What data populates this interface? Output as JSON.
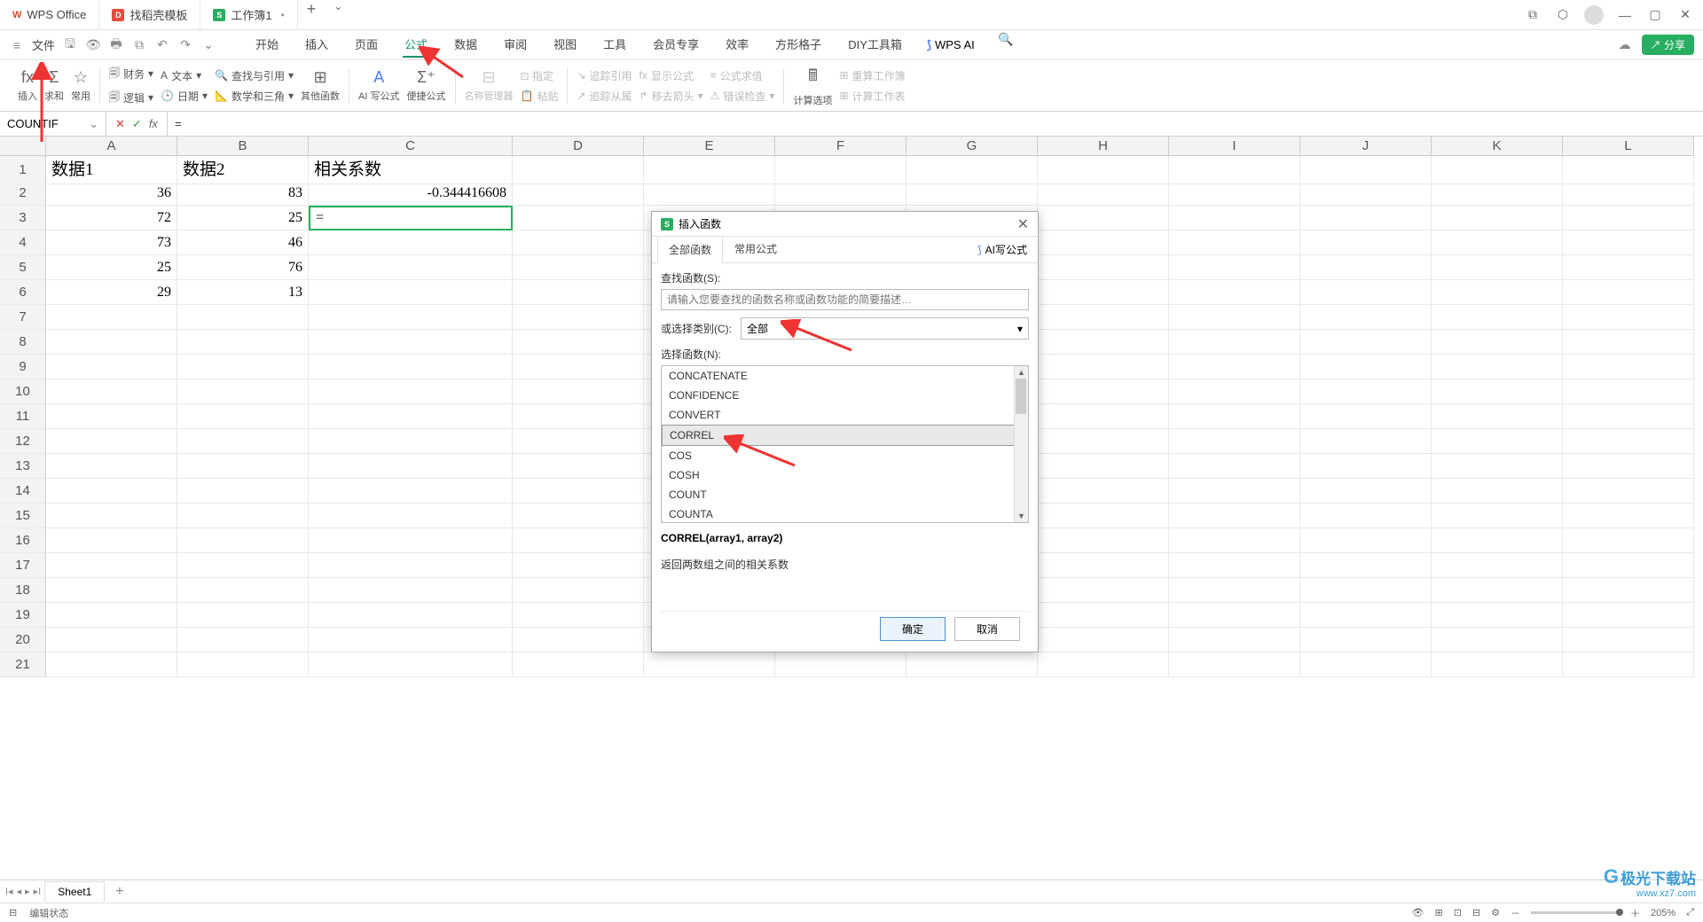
{
  "titlebar": {
    "tabs": [
      {
        "label": "WPS Office"
      },
      {
        "label": "找稻壳模板"
      },
      {
        "label": "工作簿1"
      }
    ]
  },
  "menubar": {
    "file": "文件",
    "tabs": [
      "开始",
      "插入",
      "页面",
      "公式",
      "数据",
      "审阅",
      "视图",
      "工具",
      "会员专享",
      "效率",
      "方形格子",
      "DIY工具箱"
    ],
    "active_index": 3,
    "wps_ai": "WPS AI",
    "share": "分享"
  },
  "ribbon": {
    "insert": "插入",
    "sum": "求和",
    "common": "常用",
    "finance": "财务",
    "text": "文本",
    "lookup": "查找与引用",
    "logic": "逻辑",
    "date": "日期",
    "math": "数学和三角",
    "other": "其他函数",
    "ai_formula": "AI 写公式",
    "quick_formula": "便捷公式",
    "name_mgr": "名称管理器",
    "paste": "粘贴",
    "trace_ref": "追踪引用",
    "show_formula": "显示公式",
    "formula_eval": "公式求值",
    "trace_dep": "追踪从属",
    "move_arrow": "移去箭头",
    "error_check": "错误检查",
    "calc_opt": "计算选项",
    "recalc_book": "重算工作簿",
    "calc_sheet": "计算工作表"
  },
  "formula_bar": {
    "name_box": "COUNTIF",
    "value": "="
  },
  "columns": [
    "A",
    "B",
    "C",
    "D",
    "E",
    "F",
    "G",
    "H",
    "I",
    "J",
    "K",
    "L"
  ],
  "rows": [
    "1",
    "2",
    "3",
    "4",
    "5",
    "6",
    "7",
    "8",
    "9",
    "10",
    "11",
    "12",
    "13",
    "14",
    "15",
    "16",
    "17",
    "18",
    "19",
    "20",
    "21"
  ],
  "cells": {
    "A1": "数据1",
    "B1": "数据2",
    "C1": "相关系数",
    "A2": "36",
    "B2": "83",
    "C2": "-0.344416608",
    "A3": "72",
    "B3": "25",
    "C3": "=",
    "A4": "73",
    "B4": "46",
    "A5": "25",
    "B5": "76",
    "A6": "29",
    "B6": "13"
  },
  "dialog": {
    "title": "插入函数",
    "tab_all": "全部函数",
    "tab_common": "常用公式",
    "ai_write": "AI写公式",
    "search_label": "查找函数(S):",
    "search_placeholder": "请输入您要查找的函数名称或函数功能的简要描述…",
    "category_label": "或选择类别(C):",
    "category_value": "全部",
    "select_label": "选择函数(N):",
    "functions": [
      "CONCATENATE",
      "CONFIDENCE",
      "CONVERT",
      "CORREL",
      "COS",
      "COSH",
      "COUNT",
      "COUNTA"
    ],
    "selected_index": 3,
    "signature": "CORREL(array1, array2)",
    "description": "返回两数组之间的相关系数",
    "ok": "确定",
    "cancel": "取消"
  },
  "sheet": {
    "name": "Sheet1"
  },
  "status": {
    "mode": "编辑状态",
    "zoom": "205%"
  },
  "watermark": {
    "brand": "极光下载站",
    "url": "www.xz7.com"
  }
}
